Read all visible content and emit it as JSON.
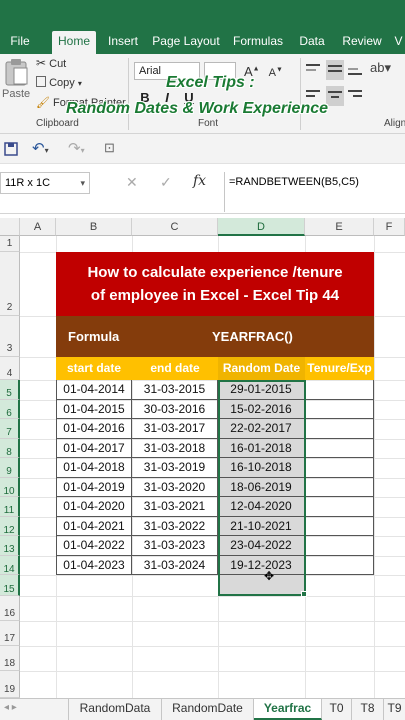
{
  "ribbon_tabs": [
    "File",
    "Home",
    "Insert",
    "Page Layout",
    "Formulas",
    "Data",
    "Review",
    "V"
  ],
  "clipboard": {
    "paste": "Paste",
    "cut": "Cut",
    "copy": "Copy",
    "format_painter": "Format Painter",
    "group_label": "Clipboard"
  },
  "font": {
    "name": "Arial",
    "group_label": "Font"
  },
  "alignment": {
    "group_label": "Align"
  },
  "overlay": {
    "line1": "Excel Tips :",
    "line2": "Random Dates & Work Experience"
  },
  "name_box": "11R x 1C",
  "formula": "=RANDBETWEEN(B5,C5)",
  "columns": [
    "A",
    "B",
    "C",
    "D",
    "E",
    "F"
  ],
  "rows": [
    "1",
    "2",
    "3",
    "4",
    "5",
    "6",
    "7",
    "8",
    "9",
    "10",
    "11",
    "12",
    "13",
    "14",
    "15",
    "16",
    "17",
    "18",
    "19"
  ],
  "title": {
    "line1": "How to calculate experience /tenure",
    "line2": "of employee in Excel - Excel Tip 44"
  },
  "formula_row": {
    "label": "Formula",
    "value": "YEARFRAC()"
  },
  "headers": [
    "start date",
    "end date",
    "Random Date",
    "Tenure/Exp"
  ],
  "data": [
    [
      "01-04-2014",
      "31-03-2015",
      "29-01-2015"
    ],
    [
      "01-04-2015",
      "30-03-2016",
      "15-02-2016"
    ],
    [
      "01-04-2016",
      "31-03-2017",
      "22-02-2017"
    ],
    [
      "01-04-2017",
      "31-03-2018",
      "16-01-2018"
    ],
    [
      "01-04-2018",
      "31-03-2019",
      "16-10-2018"
    ],
    [
      "01-04-2019",
      "31-03-2020",
      "18-06-2019"
    ],
    [
      "01-04-2020",
      "31-03-2021",
      "12-04-2020"
    ],
    [
      "01-04-2021",
      "31-03-2022",
      "21-10-2021"
    ],
    [
      "01-04-2022",
      "31-03-2023",
      "23-04-2022"
    ],
    [
      "01-04-2023",
      "31-03-2024",
      "19-12-2023"
    ]
  ],
  "sheet_tabs": [
    "RandomData",
    "RandomDate",
    "Yearfrac",
    "T0",
    "T8",
    "T9"
  ],
  "colors": {
    "excel_green": "#217346",
    "title_red": "#c00000",
    "formula_brown": "#843c0c",
    "header_gold": "#ffc000"
  }
}
